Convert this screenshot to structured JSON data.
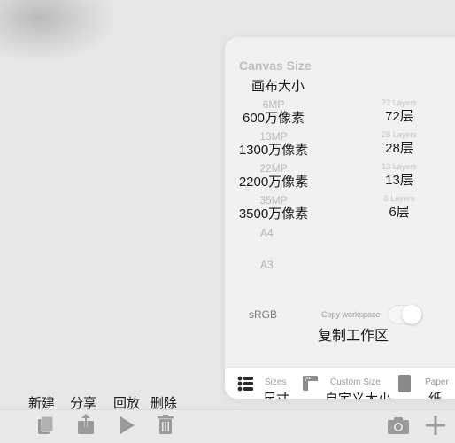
{
  "panel": {
    "title": "Canvas Size",
    "title_cn": "画布大小",
    "sizes": [
      {
        "en": "6MP",
        "cn": "600万像素",
        "layers_en": "72 Layers",
        "layers_cn": "72层"
      },
      {
        "en": "13MP",
        "cn": "1300万像素",
        "layers_en": "28 Layers",
        "layers_cn": "28层"
      },
      {
        "en": "22MP",
        "cn": "2200万像素",
        "layers_en": "13 Layers",
        "layers_cn": "13层"
      },
      {
        "en": "35MP",
        "cn": "3500万像素",
        "layers_en": "6 Layers",
        "layers_cn": "6层"
      }
    ],
    "papers": [
      "A4",
      "A3"
    ],
    "color_space": "sRGB",
    "copy_workspace": "Copy workspace",
    "copy_workspace_cn": "复制工作区",
    "copy_workspace_on": true,
    "tabs": {
      "sizes": "Sizes",
      "sizes_cn": "尺寸",
      "custom": "Custom Size",
      "custom_cn": "自定义大小",
      "paper": "Paper",
      "paper_cn": "纸"
    }
  },
  "toolbar": {
    "new_label": "新建",
    "share_label": "分享",
    "replay_label": "回放",
    "delete_label": "删除"
  },
  "icons": {
    "new": "copy-icon",
    "share": "share-icon",
    "replay": "play-icon",
    "delete": "trash-icon",
    "camera": "camera-icon",
    "add": "plus-icon"
  },
  "colors": {
    "icon_gray": "#9a9a9a",
    "text": "#1a1a1a"
  }
}
